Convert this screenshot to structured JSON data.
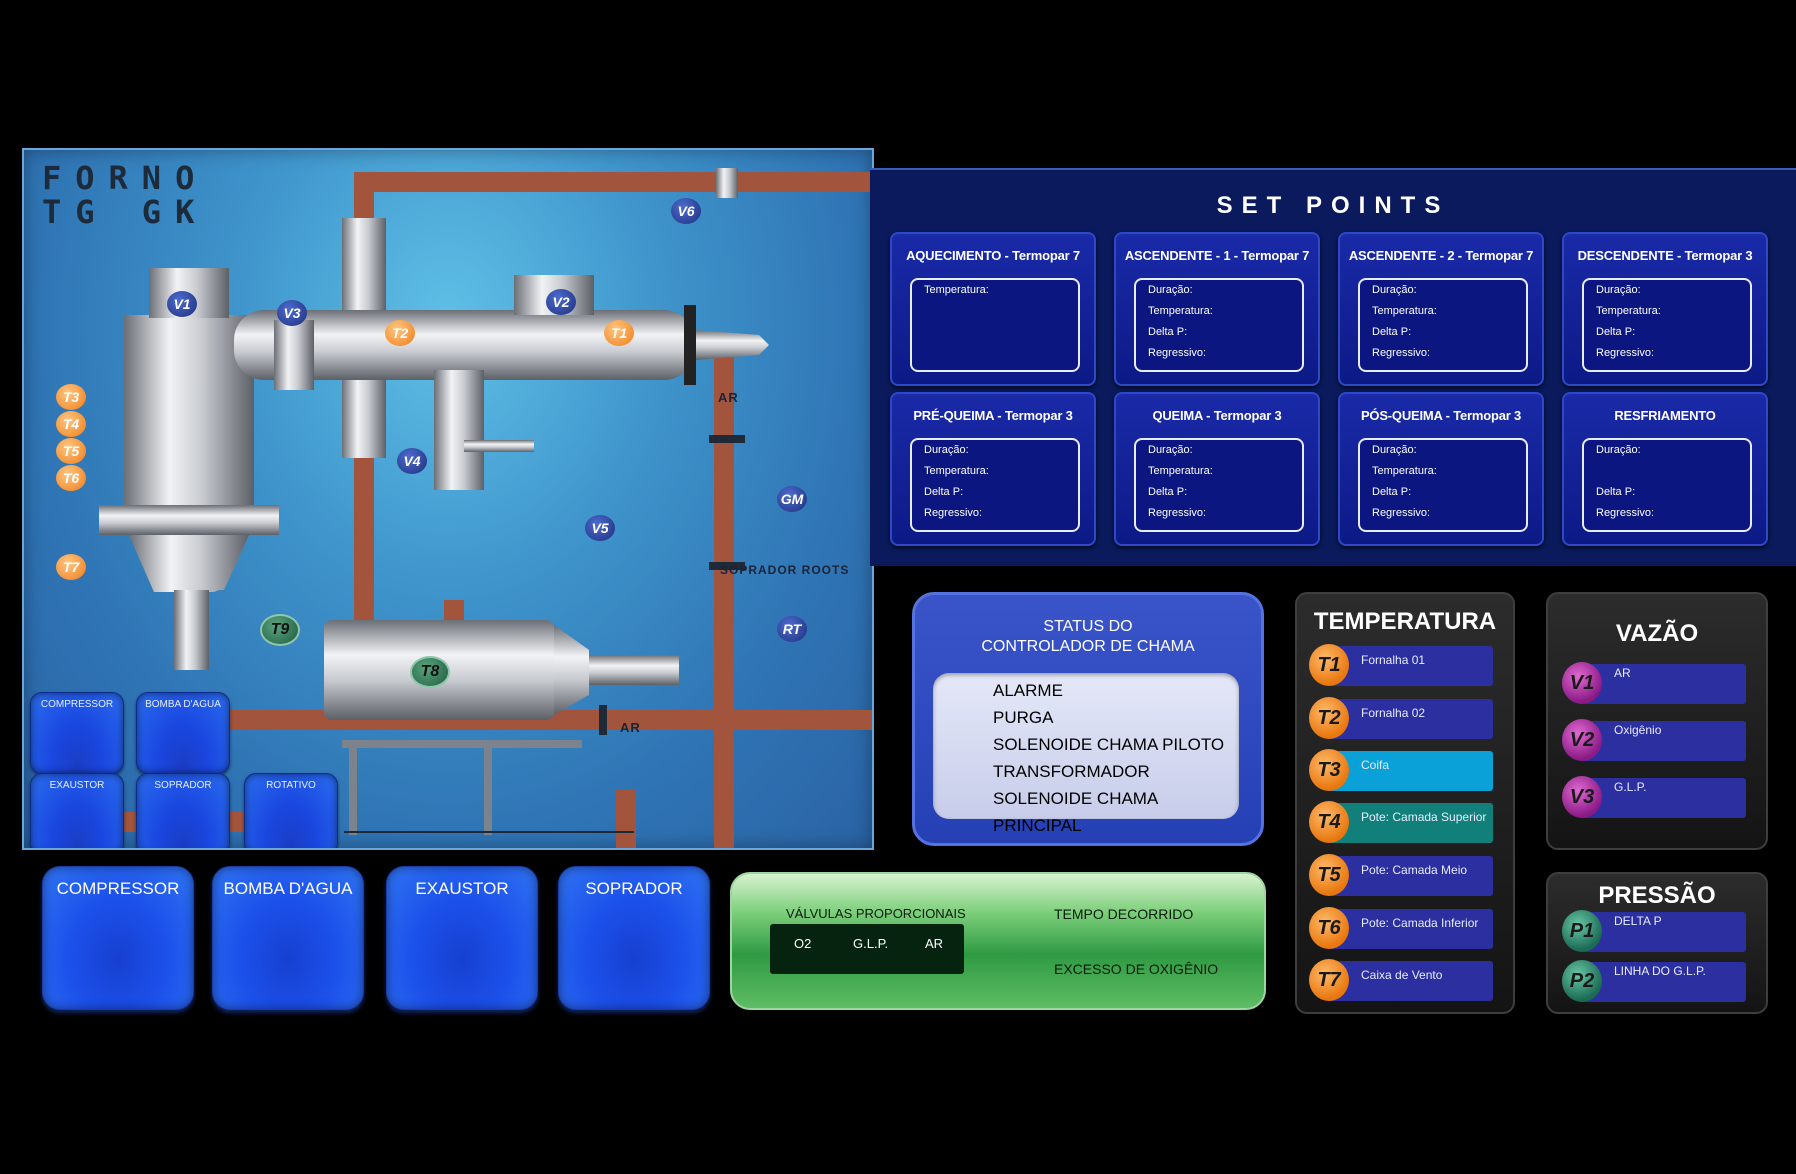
{
  "furnace": {
    "title_line1": "FORNO",
    "title_line2": "TG GK",
    "labels": {
      "ar_top": "AR",
      "ar_bottom": "AR",
      "soprador": "SOPRADOR ROOTS"
    },
    "tags": {
      "V1": "V1",
      "V2": "V2",
      "V3": "V3",
      "V4": "V4",
      "V5": "V5",
      "V6": "V6",
      "T1": "T1",
      "T2": "T2",
      "T3": "T3",
      "T4": "T4",
      "T5": "T5",
      "T6": "T6",
      "T7": "T7",
      "T8": "T8",
      "T9": "T9",
      "GM": "GM",
      "RT": "RT"
    },
    "mini_buttons": [
      "COMPRESSOR",
      "BOMBA D'AGUA",
      "EXAUSTOR",
      "SOPRADOR",
      "ROTATIVO"
    ]
  },
  "setpoints": {
    "title": "SET   POINTS",
    "cards": [
      {
        "title": "AQUECIMENTO - Termopar 7",
        "lines": [
          "Temperatura:"
        ]
      },
      {
        "title": "ASCENDENTE - 1 - Termopar 7",
        "lines": [
          "Duração:",
          "Temperatura:",
          "Delta P:",
          "Regressivo:"
        ]
      },
      {
        "title": "ASCENDENTE - 2 - Termopar 7",
        "lines": [
          "Duração:",
          "Temperatura:",
          "Delta P:",
          "Regressivo:"
        ]
      },
      {
        "title": "DESCENDENTE - Termopar 3",
        "lines": [
          "Duração:",
          "Temperatura:",
          "Delta P:",
          "Regressivo:"
        ]
      },
      {
        "title": "PRÉ-QUEIMA - Termopar 3",
        "lines": [
          "Duração:",
          "Temperatura:",
          "Delta P:",
          "Regressivo:"
        ]
      },
      {
        "title": "QUEIMA - Termopar 3",
        "lines": [
          "Duração:",
          "Temperatura:",
          "Delta P:",
          "Regressivo:"
        ]
      },
      {
        "title": "PÓS-QUEIMA - Termopar 3",
        "lines": [
          "Duração:",
          "Temperatura:",
          "Delta P:",
          "Regressivo:"
        ]
      },
      {
        "title": "RESFRIAMENTO",
        "lines": [
          "Duração:",
          "",
          "Delta P:",
          "Regressivo:"
        ]
      }
    ]
  },
  "status": {
    "title_line1": "STATUS DO",
    "title_line2": "CONTROLADOR DE CHAMA",
    "items": [
      "ALARME",
      "PURGA",
      "SOLENOIDE CHAMA PILOTO",
      "TRANSFORMADOR",
      "SOLENOIDE CHAMA PRINCIPAL"
    ]
  },
  "temperatura": {
    "title": "TEMPERATURA",
    "rows": [
      {
        "tag": "T1",
        "label": "Fornalha 01"
      },
      {
        "tag": "T2",
        "label": "Fornalha 02"
      },
      {
        "tag": "T3",
        "label": "Coifa"
      },
      {
        "tag": "T4",
        "label": "Pote: Camada Superior"
      },
      {
        "tag": "T5",
        "label": "Pote: Camada Meio"
      },
      {
        "tag": "T6",
        "label": "Pote: Camada Inferior"
      },
      {
        "tag": "T7",
        "label": "Caixa de Vento"
      }
    ],
    "highlight_colors": {
      "T3": "#0aa0d8",
      "T4": "#12807a"
    }
  },
  "vazao": {
    "title": "VAZÃO",
    "rows": [
      {
        "tag": "V1",
        "label": "AR"
      },
      {
        "tag": "V2",
        "label": "Oxigênio"
      },
      {
        "tag": "V3",
        "label": "G.L.P."
      }
    ]
  },
  "pressao": {
    "title": "PRESSÃO",
    "rows": [
      {
        "tag": "P1",
        "label": "DELTA P"
      },
      {
        "tag": "P2",
        "label": "LINHA DO G.L.P."
      }
    ]
  },
  "bottom_buttons": [
    "COMPRESSOR",
    "BOMBA D'AGUA",
    "EXAUSTOR",
    "SOPRADOR"
  ],
  "green_panel": {
    "valvulas_title": "VÁLVULAS PROPORCIONAIS",
    "valves": [
      "O2",
      "G.L.P.",
      "AR"
    ],
    "tempo": "TEMPO DECORRIDO",
    "excesso": "EXCESSO DE OXIGÊNIO"
  }
}
